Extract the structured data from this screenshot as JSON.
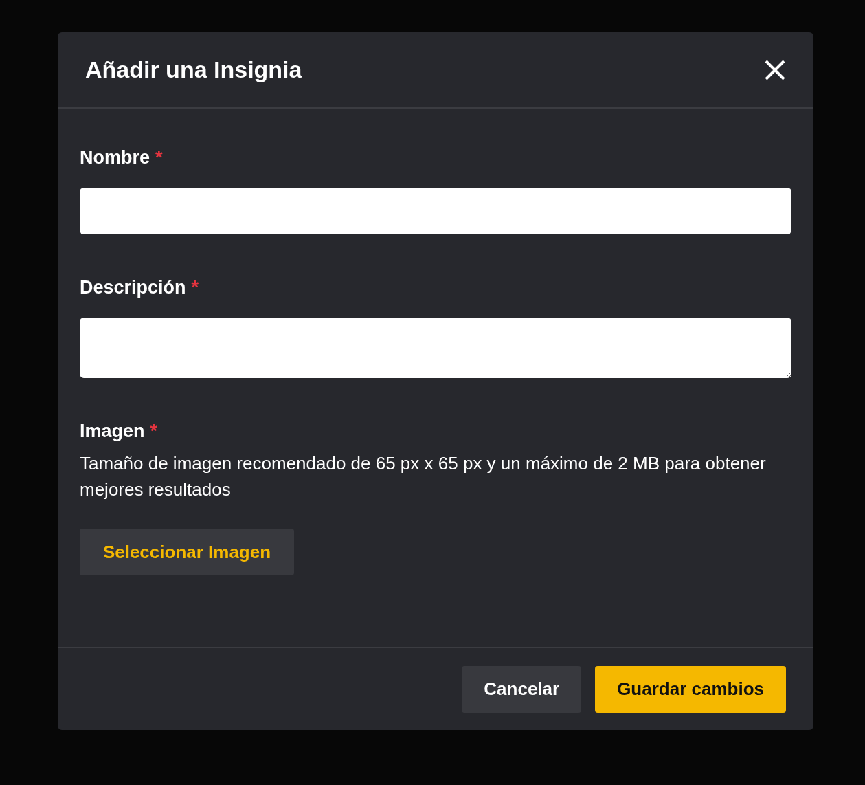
{
  "dialog": {
    "title": "Añadir una Insignia"
  },
  "fields": [
    {
      "kind": "input",
      "label": "Nombre",
      "required": true,
      "required_mark": "*"
    },
    {
      "kind": "textarea",
      "label": "Descripción",
      "required": true,
      "required_mark": "*"
    },
    {
      "kind": "file",
      "label": "Imagen",
      "required": true,
      "required_mark": "*",
      "hint": "Tamaño de imagen recomendado de 65 px x 65 px y un máximo de 2 MB para obtener mejores resultados",
      "button": "Seleccionar Imagen"
    }
  ],
  "buttons": [
    {
      "kind": "secondary",
      "label": "Cancelar"
    },
    {
      "kind": "primary",
      "label": "Guardar cambios"
    }
  ]
}
